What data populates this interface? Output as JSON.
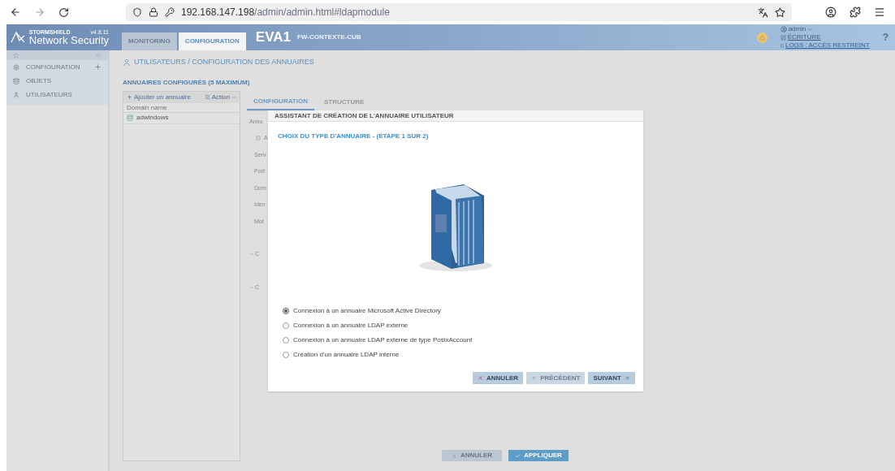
{
  "browser": {
    "url_host": "192.168.147.198",
    "url_path": "/admin/admin.html#ldapmodule"
  },
  "header": {
    "brand": "STORMSHIELD",
    "product": "Network Security",
    "version": "v4.8.11",
    "tabs": [
      {
        "label": "MONITORING",
        "selected": false
      },
      {
        "label": "CONFIGURATION",
        "selected": true
      }
    ],
    "firewall_name": "EVA1",
    "firewall_context": "FW-CONTEXTE-CUB",
    "user": "admin",
    "access_link": "ÉCRITURE",
    "logs_link": "LOGS : ACCÈS RESTREINT",
    "help": "?"
  },
  "sidebar": {
    "items": [
      {
        "label": "CONFIGURATION",
        "expandable": true
      },
      {
        "label": "OBJETS",
        "expandable": false
      },
      {
        "label": "UTILISATEURS",
        "expandable": false
      }
    ]
  },
  "page_title": "UTILISATEURS / CONFIGURATION DES ANNUAIRES",
  "directories": {
    "heading": "ANNUAIRES CONFIGURÉS (5 MAXIMUM)",
    "add_button": "Ajouter un annuaire",
    "action_button": "Action",
    "column": "Domain name",
    "rows": [
      "adwindows"
    ]
  },
  "config_tabs": [
    {
      "label": "CONFIGURATION",
      "selected": true
    },
    {
      "label": "STRUCTURE",
      "selected": false
    }
  ],
  "config_panel": {
    "legend": "Annu",
    "checkbox_label": "A",
    "fields": [
      "Serv",
      "Port",
      "Dom",
      "Iden",
      "Mot"
    ],
    "sections": [
      "C",
      "C"
    ]
  },
  "dialog": {
    "title": "ASSISTANT DE CRÉATION DE L'ANNUAIRE UTILISATEUR",
    "step": "CHOIX DU TYPE D'ANNUAIRE - (ÉTAPE 1 SUR 2)",
    "options": [
      {
        "label": "Connexion à un annuaire Microsoft Active Directory",
        "selected": true
      },
      {
        "label": "Connexion à un annuaire LDAP externe",
        "selected": false
      },
      {
        "label": "Connexion à un annuaire LDAP externe de type PosixAccount",
        "selected": false
      },
      {
        "label": "Création d'un annuaire LDAP interne",
        "selected": false
      }
    ],
    "buttons": [
      {
        "label": "ANNULER",
        "kind": "cancel",
        "disabled": false
      },
      {
        "label": "PRÉCÉDENT",
        "kind": "previous",
        "disabled": true
      },
      {
        "label": "SUIVANT",
        "kind": "next",
        "disabled": false
      }
    ]
  },
  "footer_buttons": [
    {
      "label": "ANNULER",
      "kind": "cancel",
      "disabled": true
    },
    {
      "label": "APPLIQUER",
      "kind": "apply",
      "disabled": false
    }
  ]
}
